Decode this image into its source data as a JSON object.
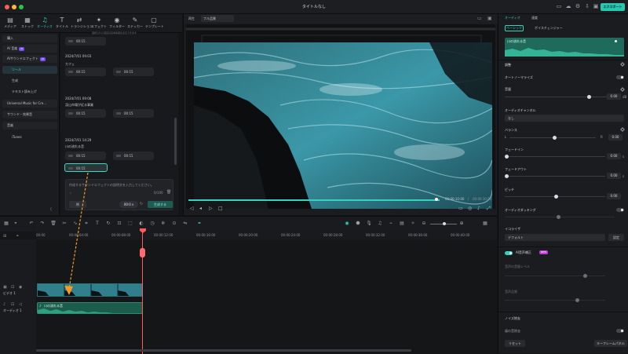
{
  "window": {
    "title": "タイトルなし",
    "export_label": "エクスポート"
  },
  "toolbar": {
    "items": [
      {
        "label": "メディア",
        "icon": "media-icon"
      },
      {
        "label": "ストック",
        "icon": "stock-icon"
      },
      {
        "label": "オーディオ",
        "icon": "music-note-icon",
        "active": true
      },
      {
        "label": "タイトル",
        "icon": "title-icon"
      },
      {
        "label": "トランジション",
        "icon": "transition-icon"
      },
      {
        "label": "エフェクト",
        "icon": "effects-icon"
      },
      {
        "label": "フィルター",
        "icon": "filter-icon"
      },
      {
        "label": "ステッカー",
        "icon": "sticker-icon"
      },
      {
        "label": "テンプレート",
        "icon": "template-icon"
      }
    ]
  },
  "sidebar": {
    "items": [
      {
        "label": "購入"
      },
      {
        "label": "AI 音楽",
        "badge": "AI"
      },
      {
        "label": "AIサウンドエフェクト",
        "badge": "AI"
      },
      {
        "label": "ツール",
        "active": true,
        "sub": true
      },
      {
        "label": "生成",
        "sub": true
      },
      {
        "label": "テキスト読み上げ",
        "sub": true
      },
      {
        "label": "Universal Music for Cre..."
      },
      {
        "label": "サウンド・効果音"
      },
      {
        "label": "音楽"
      },
      {
        "label": "iTunes"
      }
    ]
  },
  "media": {
    "top_note": "選択された項目の基本情報を表示できます",
    "groups": [
      {
        "date": "",
        "name": "",
        "clips": [
          "00:15"
        ]
      },
      {
        "date": "2024/7/01 09:03",
        "name": "カフェ",
        "clips": [
          "00:15",
          "00:15"
        ]
      },
      {
        "date": "2024/7/01 09:08",
        "name": "渓山市場が近る事業",
        "clips": [
          "00:15",
          "00:15"
        ]
      },
      {
        "date": "2024/7/01 14:29",
        "name": "川の流れる音",
        "clips": [
          "00:15",
          "00:15",
          "00:15"
        ]
      }
    ],
    "sfx": {
      "placeholder": "作成するサウンドエフェクトの説明文を入力してください。",
      "count": "0/100",
      "sample_label": "例",
      "duration": "00:0 s",
      "generate_label": "生成する"
    }
  },
  "preview": {
    "label": "再生",
    "quality": "フル品質",
    "current_time": "00:00:10:00",
    "total_time": "00:00:10:00"
  },
  "right": {
    "tabs": [
      "オーディオ",
      "速度"
    ],
    "subtabs": [
      "ベーシック",
      "ボイスチェンジャー"
    ],
    "clip_name": "川の流れる音",
    "sections": {
      "adjust": "調整",
      "auto_normalize": "オートノーマライズ",
      "volume": "音量",
      "volume_value": "0.00",
      "volume_unit": "dB",
      "channel": "オーディオチャンネル",
      "channel_value": "なし",
      "balance": "バランス",
      "balance_l": "L",
      "balance_r": "R",
      "balance_value": "0.00",
      "fade_in": "フェードイン",
      "fade_in_value": "0.00",
      "fade_in_unit": "s",
      "fade_out": "フェードアウト",
      "fade_out_value": "0.00",
      "fade_out_unit": "s",
      "pitch": "ピッチ",
      "pitch_value": "0.00",
      "ducking": "オーディオダッキング",
      "equalizer": "イコライザ",
      "eq_value": "デフォルト",
      "eq_setting": "設定",
      "ai_voice": "AI音声補正",
      "ai_voice_badge": "NEW",
      "gain": "音声の音量レベル",
      "gain2": "音声品質",
      "noise": "ノイズ除去",
      "noise_sub": "風の音除去",
      "reset": "リセット",
      "keyframe": "キーフレームパネル"
    }
  },
  "timeline": {
    "ruler": [
      "00:00",
      "00:00:04:00",
      "00:00:08:00",
      "00:00:12:00",
      "00:00:16:00",
      "00:00:20:00",
      "00:00:24:00",
      "00:00:28:00",
      "00:00:32:00",
      "00:00:36:00",
      "00:00:40:00"
    ],
    "video_track": "ビデオ 1",
    "audio_track": "オーディオ 1",
    "audio_clip": "川の流れる音"
  },
  "colors": {
    "accent": "#35d3bd",
    "playhead": "#ff5a5f",
    "export": "#27c7b0"
  }
}
